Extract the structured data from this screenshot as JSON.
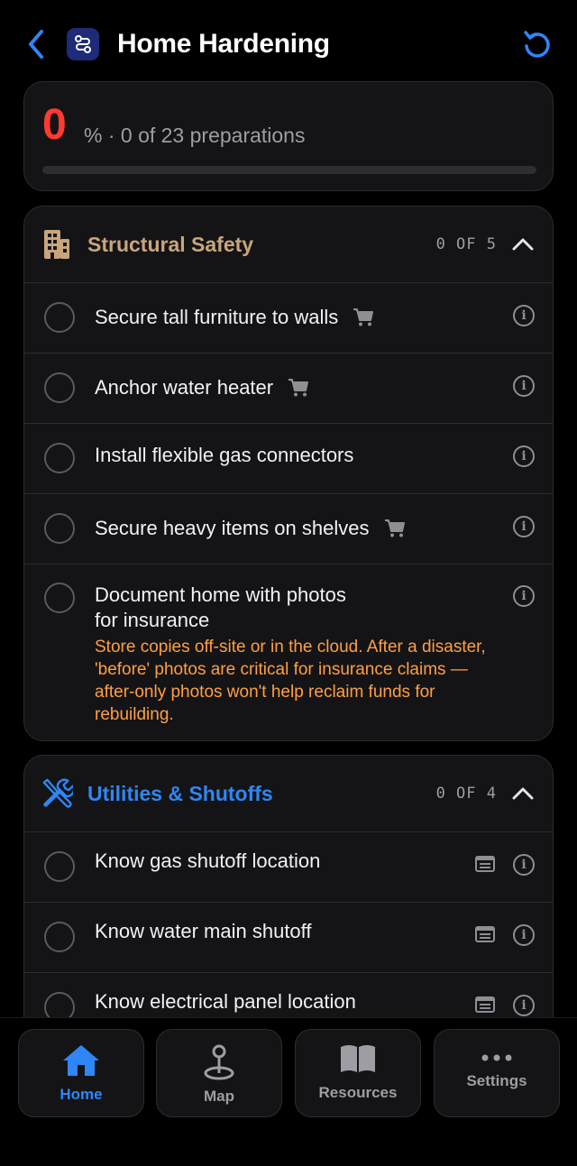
{
  "header": {
    "title": "Home Hardening",
    "back_icon": "chevron-left-icon",
    "app_icon": "route-icon",
    "reset_icon": "reset-icon",
    "accent_color": "#2f86f6"
  },
  "progress": {
    "percent_value": "0",
    "summary": "% · 0 of 23 preparations",
    "fraction": 0,
    "color": "#ff3b30"
  },
  "sections": [
    {
      "title": "Structural Safety",
      "icon": "building-icon",
      "color": "#c8a57c",
      "count": "0 OF 5",
      "items": [
        {
          "label": "Secure tall furniture to walls",
          "shopping": true
        },
        {
          "label": "Anchor water heater",
          "shopping": true
        },
        {
          "label": "Install flexible gas connectors",
          "shopping": false
        },
        {
          "label": "Secure heavy items on shelves",
          "shopping": true
        },
        {
          "label_line1": "Document home with photos",
          "label_line2": "for insurance",
          "note": "Store copies off-site or in the cloud. After a disaster, 'before' photos are critical for insurance claims — after-only photos won't help reclaim funds for rebuilding."
        }
      ]
    },
    {
      "title": "Utilities & Shutoffs",
      "icon": "tools-icon",
      "color": "#2f86f6",
      "count": "0 OF 4",
      "items": [
        {
          "label": "Know gas shutoff location",
          "has_doc": true
        },
        {
          "label": "Know water main shutoff",
          "has_doc": true
        },
        {
          "label": "Know electrical panel location",
          "has_doc": true
        }
      ]
    }
  ],
  "tabs": [
    {
      "label": "Home",
      "icon": "house-icon",
      "active": true
    },
    {
      "label": "Map",
      "icon": "map-pin-icon",
      "active": false
    },
    {
      "label": "Resources",
      "icon": "book-icon",
      "active": false
    },
    {
      "label": "Settings",
      "icon": "more-dots-icon",
      "active": false
    }
  ]
}
